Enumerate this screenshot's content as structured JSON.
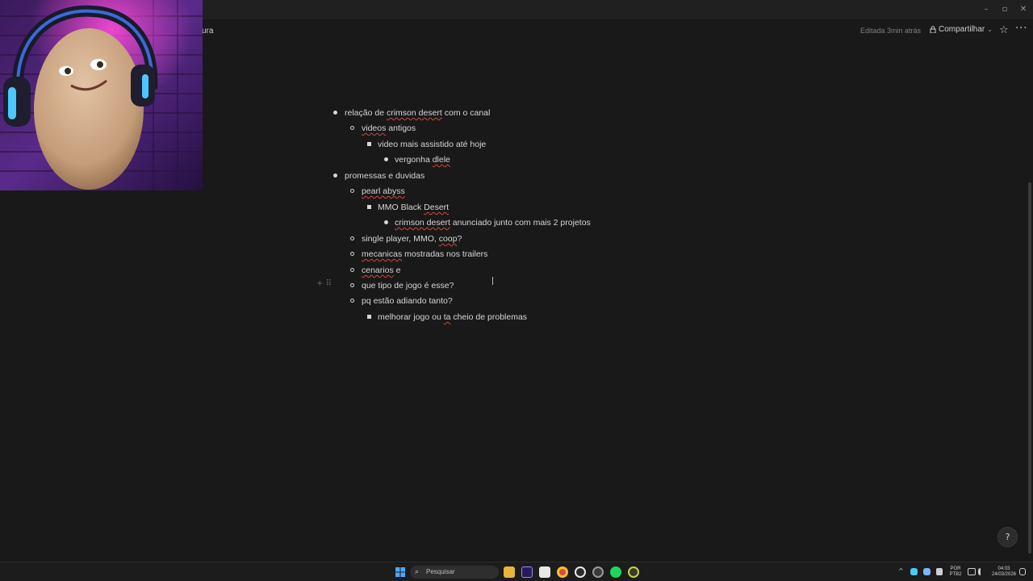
{
  "window": {
    "minimize_glyph": "–",
    "maximize_glyph": "▫",
    "close_glyph": "✕"
  },
  "topbar": {
    "breadcrumb": "ura",
    "edited": "Editada 3min atrás",
    "share_label": "Compartilhar",
    "share_chevron": "⌄",
    "star_glyph": "☆",
    "more_glyph": "···"
  },
  "document": {
    "items": [
      {
        "text": "relação de ",
        "spell": "crimson desert",
        "rest": " com o canal"
      },
      {
        "spell": "videos",
        "rest": " antigos"
      },
      {
        "text": "video mais assistido até hoje"
      },
      {
        "text": "vergonha ",
        "spell": "dlele"
      },
      {
        "text": "promessas e duvidas"
      },
      {
        "spell": "pearl abyss"
      },
      {
        "text": "MMO Black ",
        "spell": "Desert"
      },
      {
        "spell": "crimson desert",
        "rest": " anunciado junto com mais 2 projetos"
      },
      {
        "text": "single player, MMO, ",
        "spell": "coop",
        "rest": "?"
      },
      {
        "spell": "mecanicas",
        "rest": " mostradas nos trailers"
      },
      {
        "spell": "cenarios",
        "rest": " e"
      },
      {
        "text": "que tipo de jogo é esse?"
      },
      {
        "text": "pq estão adiando tanto?"
      },
      {
        "text": "melhorar jogo ou ",
        "spell": "ta",
        "rest": " cheio de problemas"
      }
    ],
    "handle_glyph": "+ ⠿"
  },
  "help_glyph": "?",
  "taskbar": {
    "search_placeholder": "Pesquisar",
    "search_icon": "⌕",
    "lang_line1": "POR",
    "lang_line2": "PTB2",
    "time": "04:03",
    "date": "24/03/2026",
    "tray_chevron": "^"
  },
  "colors": {
    "background": "#191919",
    "text": "#d6d6d6",
    "spell_underline": "#d04a3a"
  }
}
